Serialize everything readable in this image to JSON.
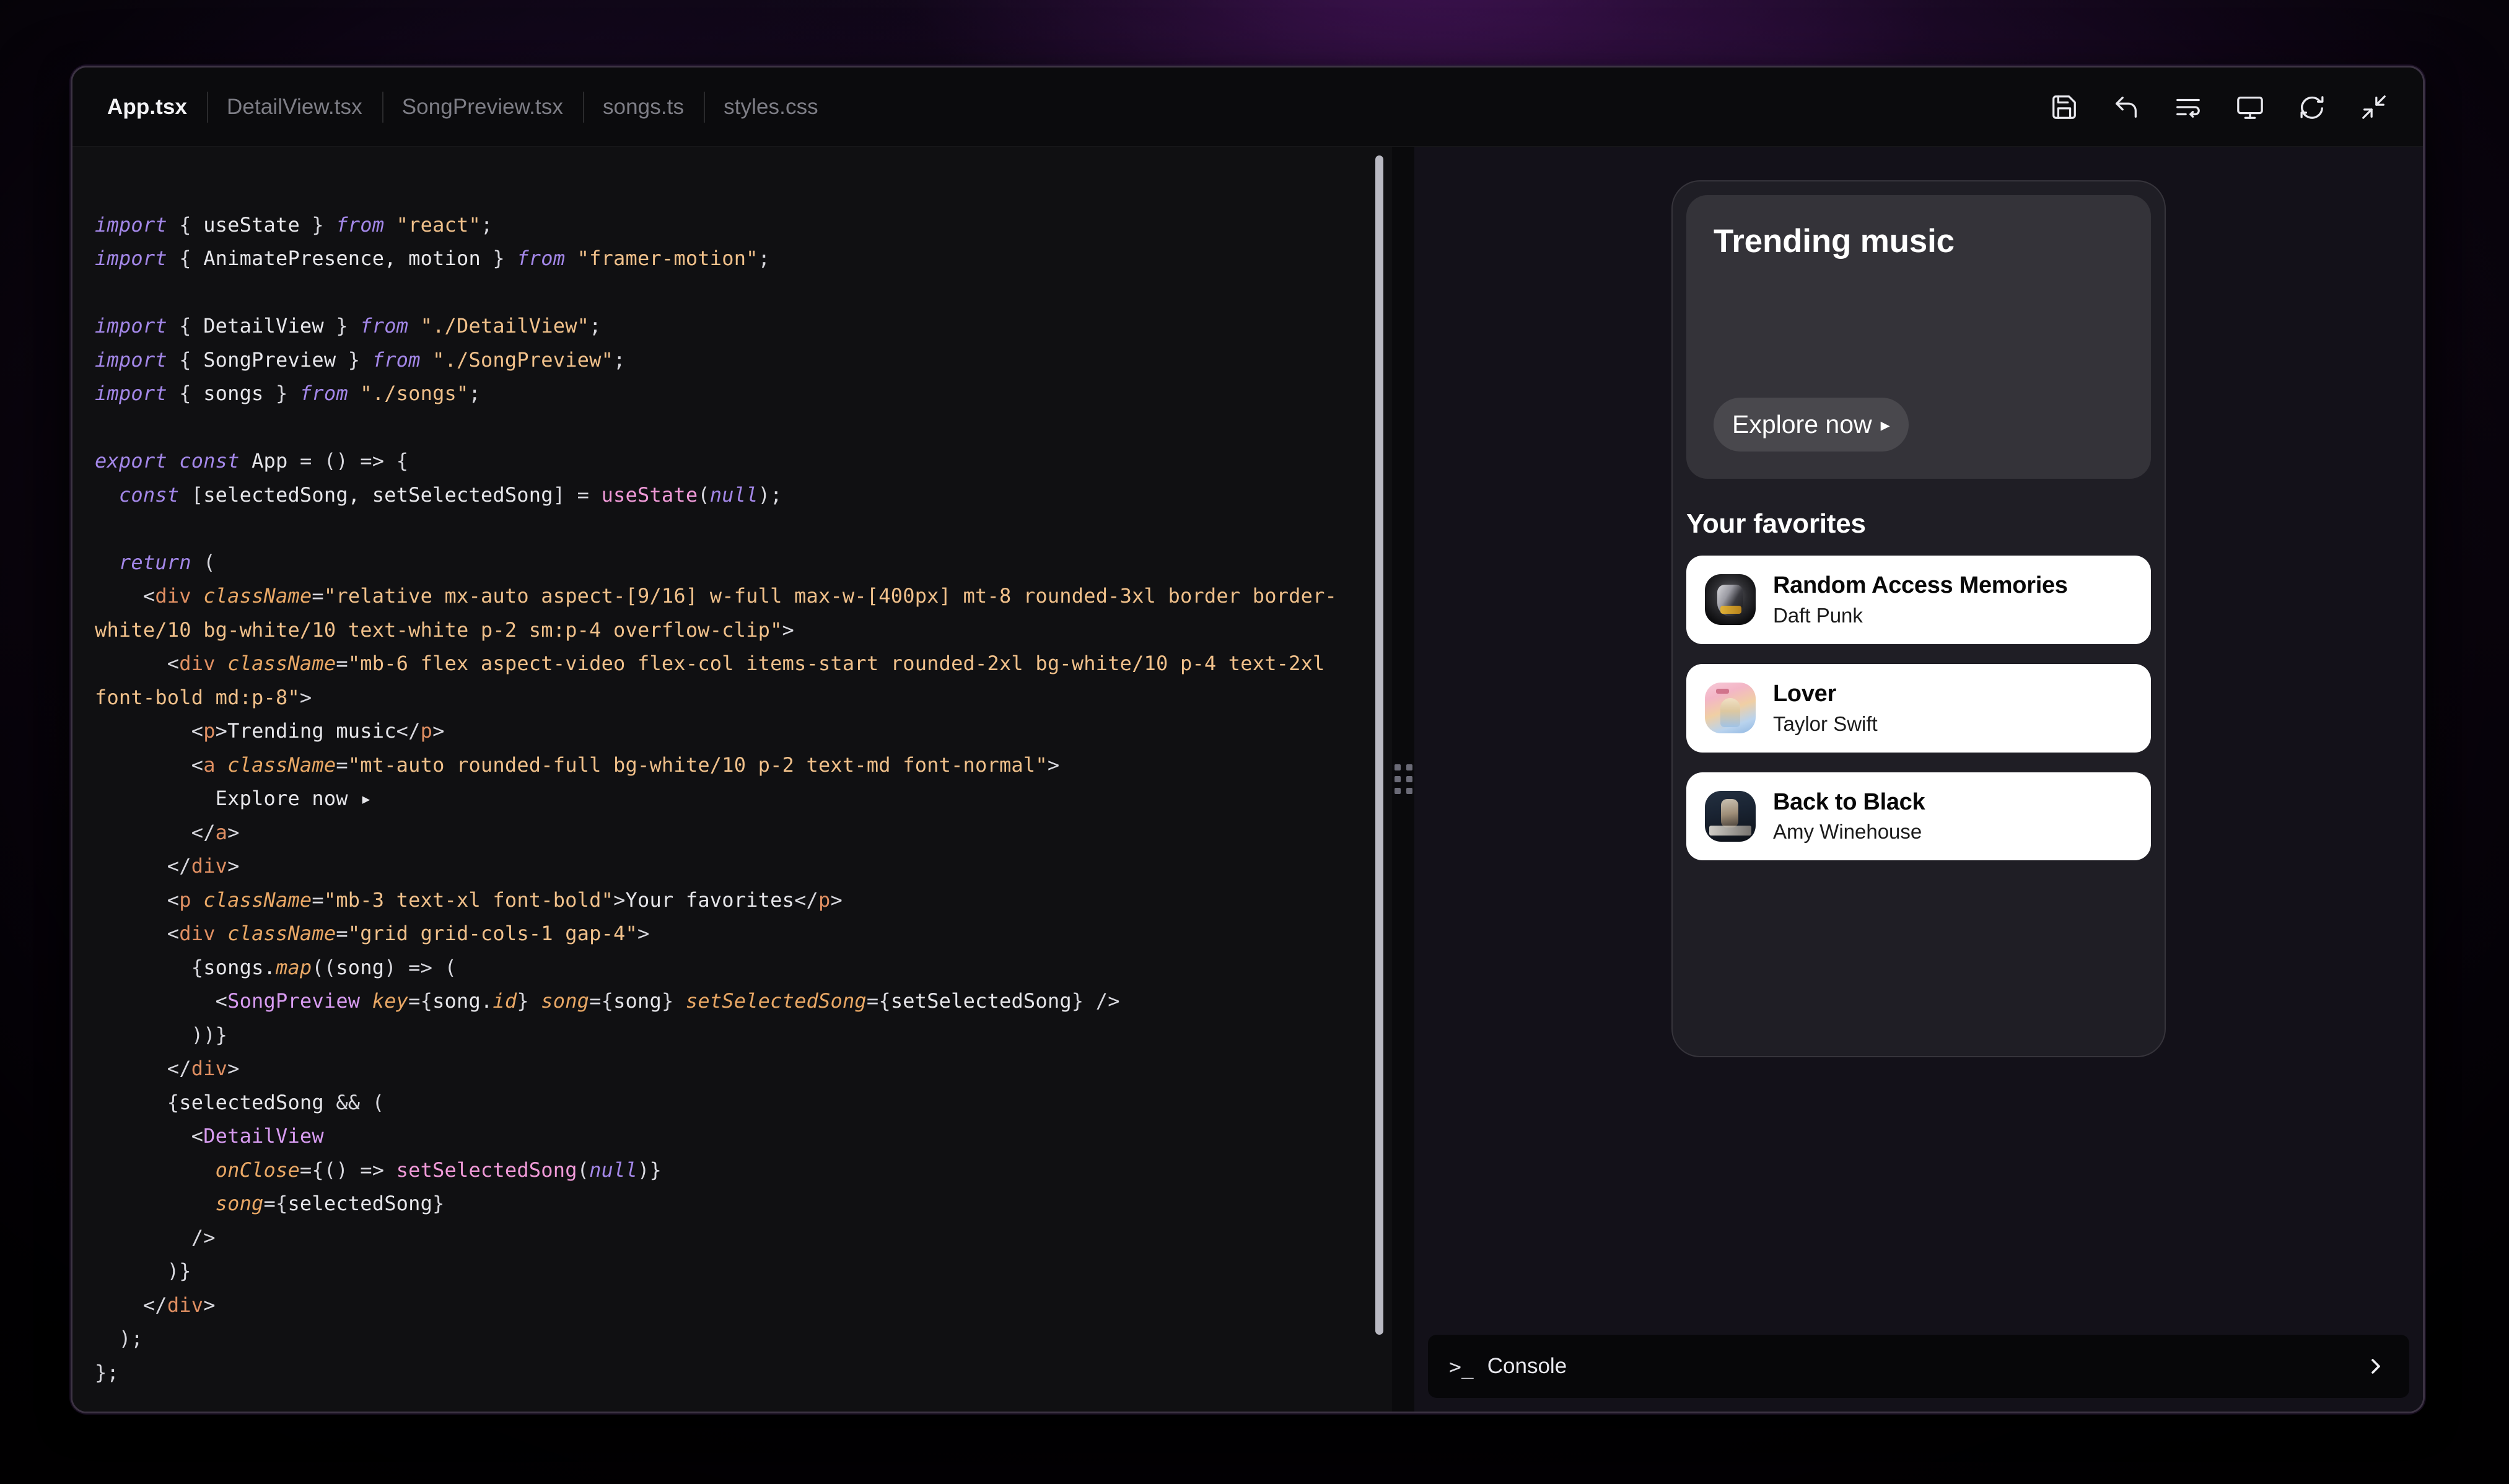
{
  "window": {
    "tabs": [
      {
        "label": "App.tsx",
        "active": true
      },
      {
        "label": "DetailView.tsx",
        "active": false
      },
      {
        "label": "SongPreview.tsx",
        "active": false
      },
      {
        "label": "songs.ts",
        "active": false
      },
      {
        "label": "styles.css",
        "active": false
      }
    ],
    "actions": [
      {
        "name": "save-icon",
        "title": "Save"
      },
      {
        "name": "undo-icon",
        "title": "Undo"
      },
      {
        "name": "wrap-lines-icon",
        "title": "Format / Wrap lines"
      },
      {
        "name": "preview-monitor-icon",
        "title": "Preview"
      },
      {
        "name": "refresh-icon",
        "title": "Reload"
      },
      {
        "name": "collapse-icon",
        "title": "Collapse"
      }
    ]
  },
  "editor": {
    "filename": "App.tsx",
    "language": "tsx",
    "code_lines": [
      "import { useState } from \"react\";",
      "import { AnimatePresence, motion } from \"framer-motion\";",
      "",
      "import { DetailView } from \"./DetailView\";",
      "import { SongPreview } from \"./SongPreview\";",
      "import { songs } from \"./songs\";",
      "",
      "export const App = () => {",
      "  const [selectedSong, setSelectedSong] = useState(null);",
      "",
      "  return (",
      "    <div className=\"relative mx-auto aspect-[9/16] w-full max-w-[400px] mt-8 rounded-3xl border border-white/10 bg-white/10 text-white p-2 sm:p-4 overflow-clip\">",
      "      <div className=\"mb-6 flex aspect-video flex-col items-start rounded-2xl bg-white/10 p-4 text-2xl font-bold md:p-8\">",
      "        <p>Trending music</p>",
      "        <a className=\"mt-auto rounded-full bg-white/10 p-2 text-md font-normal\">",
      "          Explore now ▸",
      "        </a>",
      "      </div>",
      "      <p className=\"mb-3 text-xl font-bold\">Your favorites</p>",
      "      <div className=\"grid grid-cols-1 gap-4\">",
      "        {songs.map((song) => (",
      "          <SongPreview key={song.id} song={song} setSelectedSong={setSelectedSong} />",
      "        ))}",
      "      </div>",
      "      {selectedSong && (",
      "        <DetailView",
      "          onClose={() => setSelectedSong(null)}",
      "          song={selectedSong}",
      "        />",
      "      )}",
      "    </div>",
      "  );",
      "};"
    ]
  },
  "preview": {
    "hero": {
      "title": "Trending music",
      "cta_label": "Explore now",
      "cta_caret": "▸"
    },
    "favorites": {
      "heading": "Your favorites",
      "songs": [
        {
          "title": "Random Access Memories",
          "artist": "Daft Punk",
          "art": "art-daft"
        },
        {
          "title": "Lover",
          "artist": "Taylor Swift",
          "art": "art-lover"
        },
        {
          "title": "Back to Black",
          "artist": "Amy Winehouse",
          "art": "art-amy"
        }
      ]
    }
  },
  "console": {
    "prompt": ">_",
    "label": "Console"
  },
  "colors": {
    "backdrop_purple": "#7e22a0",
    "window_bg": "#0a0a0c",
    "code_bg": "#101012",
    "preview_bg": "#131119",
    "card_white": "#ffffff",
    "keyword": "#a387e8",
    "string": "#f0c08a",
    "tag": "#e08f62",
    "attribute": "#e8a765",
    "component": "#d79bf0",
    "function": "#f09ad8"
  }
}
